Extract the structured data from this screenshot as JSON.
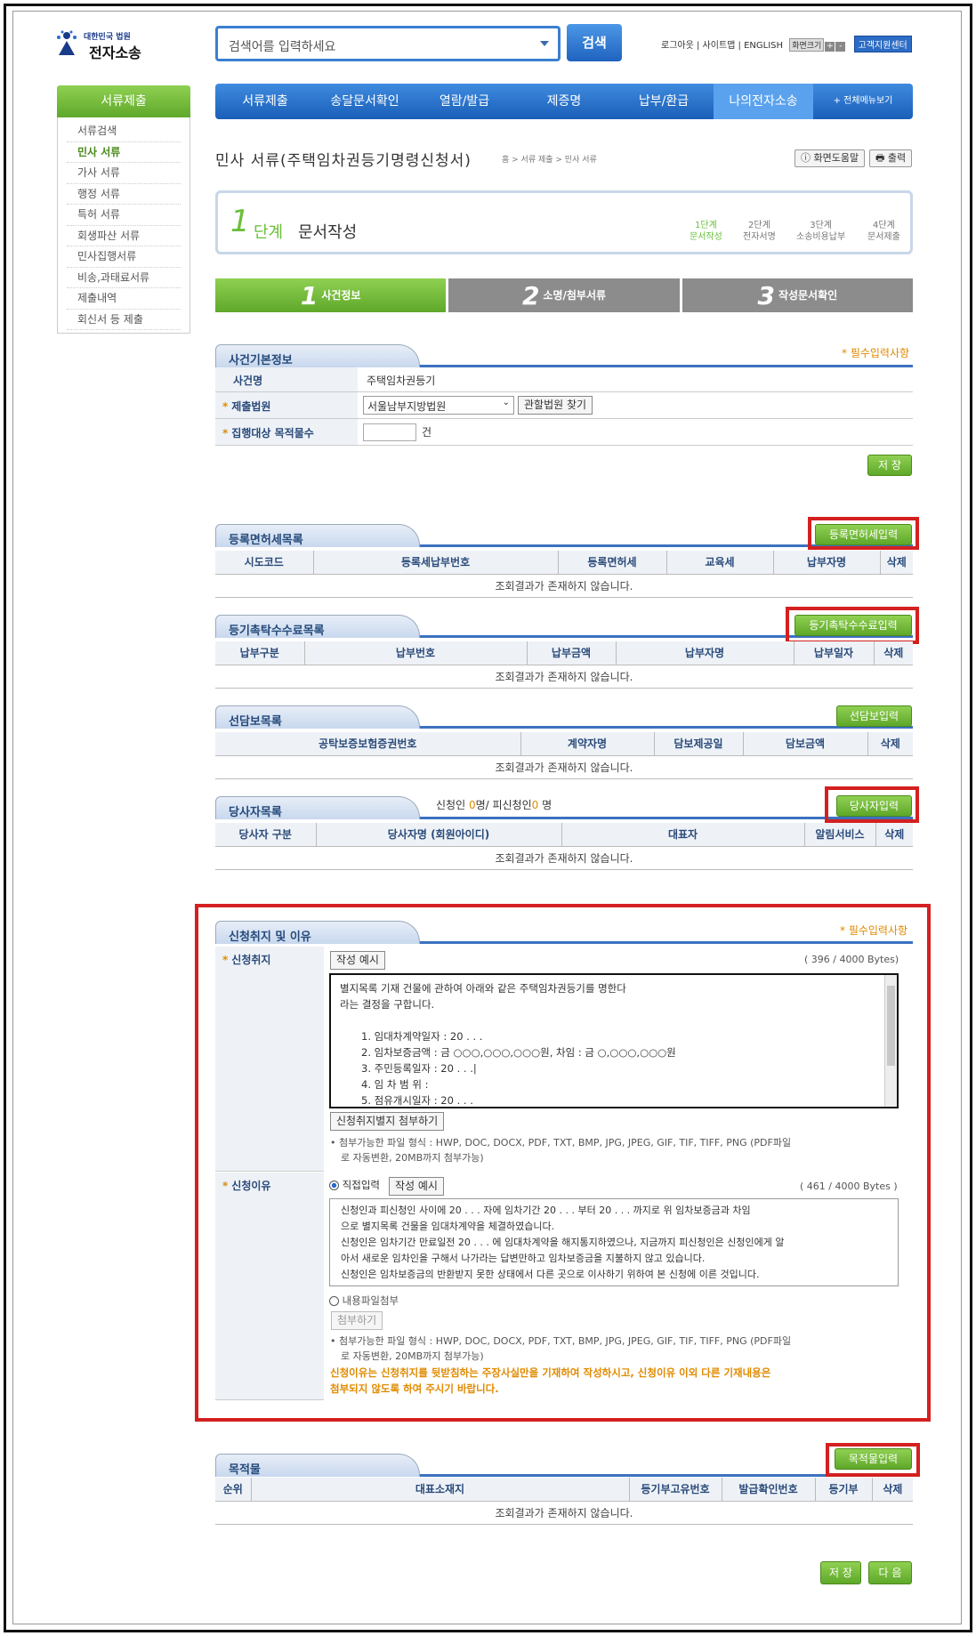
{
  "logo": {
    "line1": "대한민국 법원",
    "line2": "전자소송"
  },
  "search": {
    "placeholder": "검색어를 입력하세요",
    "button": "검색"
  },
  "util": {
    "logout": "로그아웃",
    "sitemap": "사이트맵",
    "english": "ENGLISH",
    "zoom": "화면크기",
    "plus": "+",
    "minus": "-",
    "support": "고객지원센터"
  },
  "lnav": {
    "title": "서류제출",
    "items": [
      "서류검색",
      "민사 서류",
      "가사 서류",
      "행정 서류",
      "특허 서류",
      "회생파산 서류",
      "민사집행서류",
      "비송,과태료서류",
      "제출내역",
      "회신서 등 제출"
    ]
  },
  "gnav": [
    "서류제출",
    "송달문서확인",
    "열람/발급",
    "제증명",
    "납부/환급",
    "나의전자소송",
    "+ 전체메뉴보기"
  ],
  "page": {
    "title": "민사 서류(주택임차권등기명령신청서)",
    "breadcrumb": "홈 > 서류 제출 > 민사 서류",
    "help": "화면도움말",
    "print": "출력"
  },
  "step": {
    "num": "1",
    "unit": "단계",
    "name": "문서작성",
    "progress": [
      {
        "a": "1단계",
        "b": "문서작성"
      },
      {
        "a": "2단계",
        "b": "전자서명"
      },
      {
        "a": "3단계",
        "b": "소송비용납부"
      },
      {
        "a": "4단계",
        "b": "문서제출"
      }
    ]
  },
  "tabs": [
    {
      "n": "1",
      "t": "사건정보"
    },
    {
      "n": "2",
      "t": "소명/첨부서류"
    },
    {
      "n": "3",
      "t": "작성문서확인"
    }
  ],
  "case": {
    "title": "사건기본정보",
    "req": "* 필수입력사항",
    "name_label": "사건명",
    "name_value": "주택임차권등기",
    "court_label": "제출법원",
    "court_value": "서울남부지방법원",
    "court_btn": "관할법원 찾기",
    "count_label": "집행대상 목적물수",
    "count_unit": "건",
    "save": "저 장"
  },
  "empty": "조회결과가 존재하지 않습니다.",
  "reg": {
    "title": "등록면허세목록",
    "btn": "등록면허세입력",
    "cols": [
      "시도코드",
      "등록세납부번호",
      "등록면허세",
      "교육세",
      "납부자명",
      "삭제"
    ]
  },
  "fee": {
    "title": "등기촉탁수수료목록",
    "btn": "등기촉탁수수료입력",
    "cols": [
      "납부구분",
      "납부번호",
      "납부금액",
      "납부자명",
      "납부일자",
      "삭제"
    ]
  },
  "sec": {
    "title": "선담보목록",
    "btn": "선담보입력",
    "cols": [
      "공탁보증보험증권번호",
      "계약자명",
      "담보제공일",
      "담보금액",
      "삭제"
    ]
  },
  "party": {
    "title": "당사자목록",
    "count_pre": "신청인 ",
    "count_a": "0",
    "count_mid": "명/ 피신청인",
    "count_b": "0",
    "count_post": " 명",
    "btn": "당사자입력",
    "cols": [
      "당사자 구분",
      "당사자명 (회원아이디)",
      "대표자",
      "알림서비스",
      "삭제"
    ]
  },
  "purpose": {
    "title": "신청취지 및 이유",
    "req": "* 필수입력사항",
    "label1": "신청취지",
    "example": "작성 예시",
    "bytes1": "( 396 / 4000 Bytes)",
    "text1": [
      "별지목록 기재 건물에 관하여 아래와 같은 주택임차권등기를 명한다",
      "라는 결정을 구합니다.",
      "",
      "1. 임대차계약일자 :   20 .     .     .",
      "2. 임차보증금액   :   금 ○○○,○○○,○○○원,     차임 : 금 ○,○○○,○○○원",
      "3. 주민등록일자   :   20 .     .     .|",
      "4. 임 차 범 위     :",
      "5. 점유개시일자   :   20 .     .     ."
    ],
    "attach_btn": "신청취지별지 첨부하기",
    "note1a": "• 첨부가능한 파일 형식 : HWP, DOC, DOCX, PDF, TXT, BMP, JPG, JPEG, GIF, TIF, TIFF, PNG (PDF파일",
    "note1b": "로 자동변환, 20MB까지 첨부가능)",
    "label2": "신청이유",
    "radio1": "직접입력",
    "bytes2": "( 461 / 4000 Bytes )",
    "text2": [
      "신청인과 피신청인 사이에 20 .   .   .  자에 임차기간 20 .   .   .  부터 20 .   .   .   까지로 위 임차보증금과 차임",
      "으로 별지목록 건물을 임대차계약을 체결하였습니다.",
      "신청인은 임차기간 만료일전 20 .   .   .  에 임대차계약을 해지통지하였으나, 지금까지 피신청인은 신청인에게 알",
      "아서 새로운 임차인을 구해서 나가라는 답변만하고 임차보증금을 지불하지 않고 있습니다.",
      "신청인은 임차보증금의 반환받지 못한 상태에서 다른 곳으로 이사하기 위하여 본 신청에 이른 것입니다."
    ],
    "radio2": "내용파일첨부",
    "attach2": "첨부하기",
    "warn": [
      "신청이유는 신청취지를 뒷받침하는 주장사실만을 기재하여 작성하시고, 신청이유 이외 다른 기재내용은",
      "첨부되지 않도록 하여 주시기 바랍니다."
    ]
  },
  "obj": {
    "title": "목적물",
    "btn": "목적물입력",
    "cols": [
      "순위",
      "대표소재지",
      "등기부고유번호",
      "발급확인번호",
      "등기부",
      "삭제"
    ]
  },
  "footer": {
    "save": "저 장",
    "next": "다 음"
  }
}
